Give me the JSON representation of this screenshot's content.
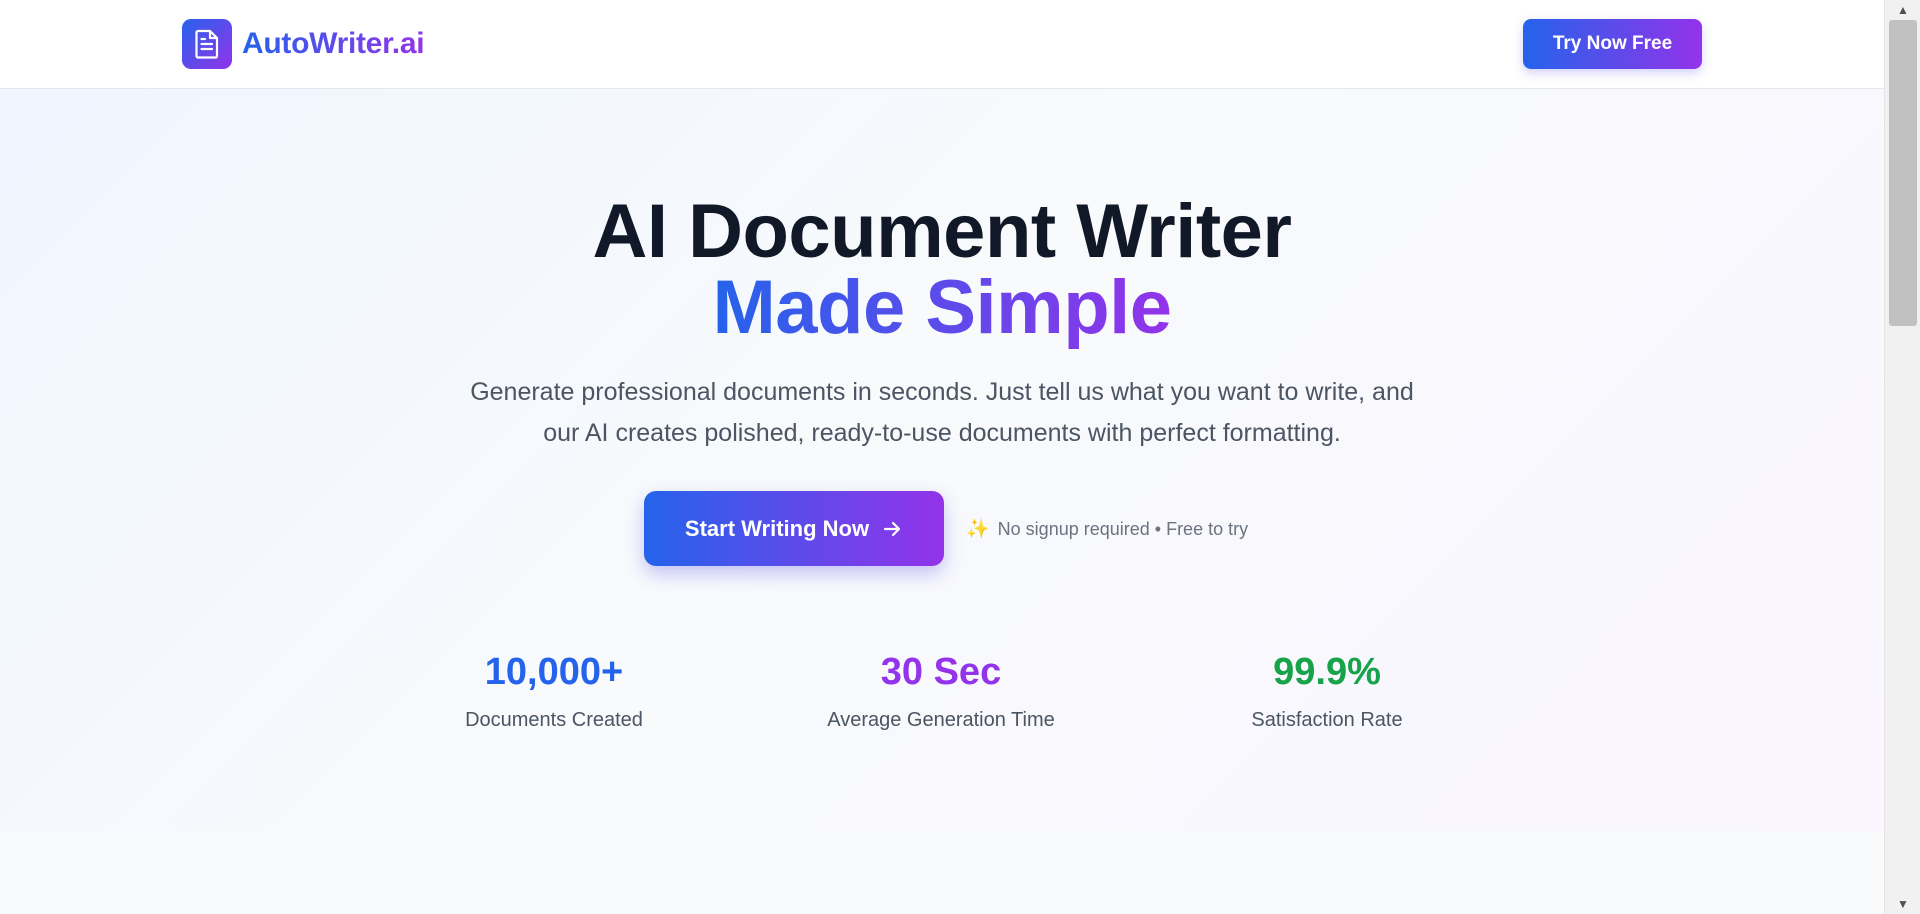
{
  "header": {
    "brand": "AutoWriter.ai",
    "logo_icon": "document-icon",
    "cta_label": "Try Now Free"
  },
  "hero": {
    "headline_line1": "AI Document Writer",
    "headline_line2": "Made Simple",
    "subtitle_line1": "Generate professional documents in seconds. Just tell us what you want to write, and",
    "subtitle_line2": "our AI creates polished, ready-to-use documents with perfect formatting.",
    "cta_label": "Start Writing Now",
    "cta_icon": "arrow-right-icon",
    "note_icon": "sparkles-icon",
    "note_sparkle": "✨",
    "note": "No signup required • Free to try"
  },
  "stats": [
    {
      "value": "10,000+",
      "label": "Documents Created",
      "color": "#2563eb"
    },
    {
      "value": "30 Sec",
      "label": "Average Generation Time",
      "color": "#9333ea"
    },
    {
      "value": "99.9%",
      "label": "Satisfaction Rate",
      "color": "#16a34a"
    }
  ],
  "colors": {
    "gradient_start": "#2563eb",
    "gradient_end": "#9333ea",
    "heading": "#111827",
    "body_text": "#4b5563"
  }
}
